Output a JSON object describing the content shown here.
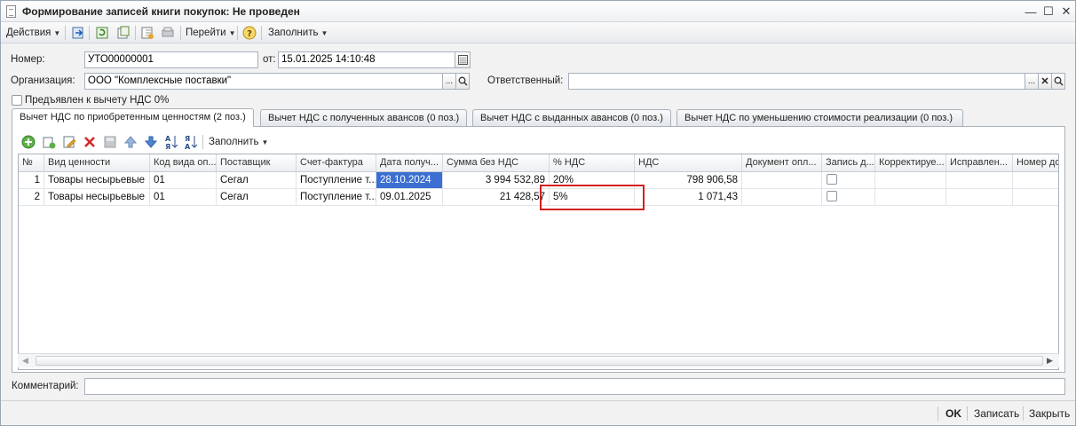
{
  "window": {
    "title": "Формирование записей книги покупок: Не проведен"
  },
  "toolbar": {
    "actions_label": "Действия",
    "goto_label": "Перейти",
    "fill_label": "Заполнить"
  },
  "form": {
    "number_label": "Номер:",
    "number_value": "УТО00000001",
    "date_label": "от:",
    "date_value": "15.01.2025 14:10:48",
    "org_label": "Организация:",
    "org_value": "ООО \"Комплексные поставки\"",
    "responsible_label": "Ответственный:",
    "responsible_value": "",
    "vat0_label": "Предъявлен к вычету НДС 0%"
  },
  "tabs": [
    {
      "label": "Вычет НДС по приобретенным ценностям (2 поз.)"
    },
    {
      "label": "Вычет НДС с полученных авансов (0 поз.)"
    },
    {
      "label": "Вычет НДС с выданных авансов (0 поз.)"
    },
    {
      "label": "Вычет НДС по уменьшению стоимости реализации (0 поз.)"
    }
  ],
  "grid_toolbar": {
    "fill_label": "Заполнить"
  },
  "grid": {
    "columns": [
      "№",
      "Вид ценности",
      "Код вида оп...",
      "Поставщик",
      "Счет-фактура",
      "Дата получ...",
      "Сумма без НДС",
      "% НДС",
      "НДС",
      "Документ опл...",
      "Запись д...",
      "Корректируе...",
      "Исправлен...",
      "Номер до"
    ],
    "rows": [
      {
        "n": "1",
        "kind": "Товары несырьевые",
        "code": "01",
        "supplier": "Сегал",
        "invoice": "Поступление т...",
        "date": "28.10.2024",
        "sum": "3 994 532,89",
        "rate": "20%",
        "vat": "798 906,58",
        "doc": ""
      },
      {
        "n": "2",
        "kind": "Товары несырьевые",
        "code": "01",
        "supplier": "Сегал",
        "invoice": "Поступление т...",
        "date": "09.01.2025",
        "sum": "21 428,57",
        "rate": "5%",
        "vat": "1 071,43",
        "doc": ""
      }
    ]
  },
  "comment": {
    "label": "Комментарий:",
    "value": ""
  },
  "buttons": {
    "ok": "OK",
    "save": "Записать",
    "close": "Закрыть"
  },
  "colors": {
    "selection": "#3b6fd1",
    "highlight_box": "#d42020"
  }
}
